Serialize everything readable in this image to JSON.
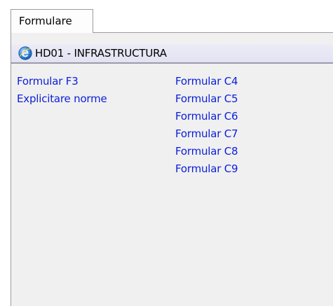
{
  "tab": {
    "label": "Formulare"
  },
  "group": {
    "title": "HD01 - INFRASTRUCTURA",
    "icon": "internet-explorer-icon"
  },
  "links": {
    "left": [
      "Formular F3",
      "Explicitare norme"
    ],
    "right": [
      "Formular C4",
      "Formular C5",
      "Formular C6",
      "Formular C7",
      "Formular C8",
      "Formular C9"
    ]
  },
  "colors": {
    "link": "#0b1fd8",
    "panel_bg": "#f0f0f0",
    "header_bg": "#e6e6f5"
  }
}
